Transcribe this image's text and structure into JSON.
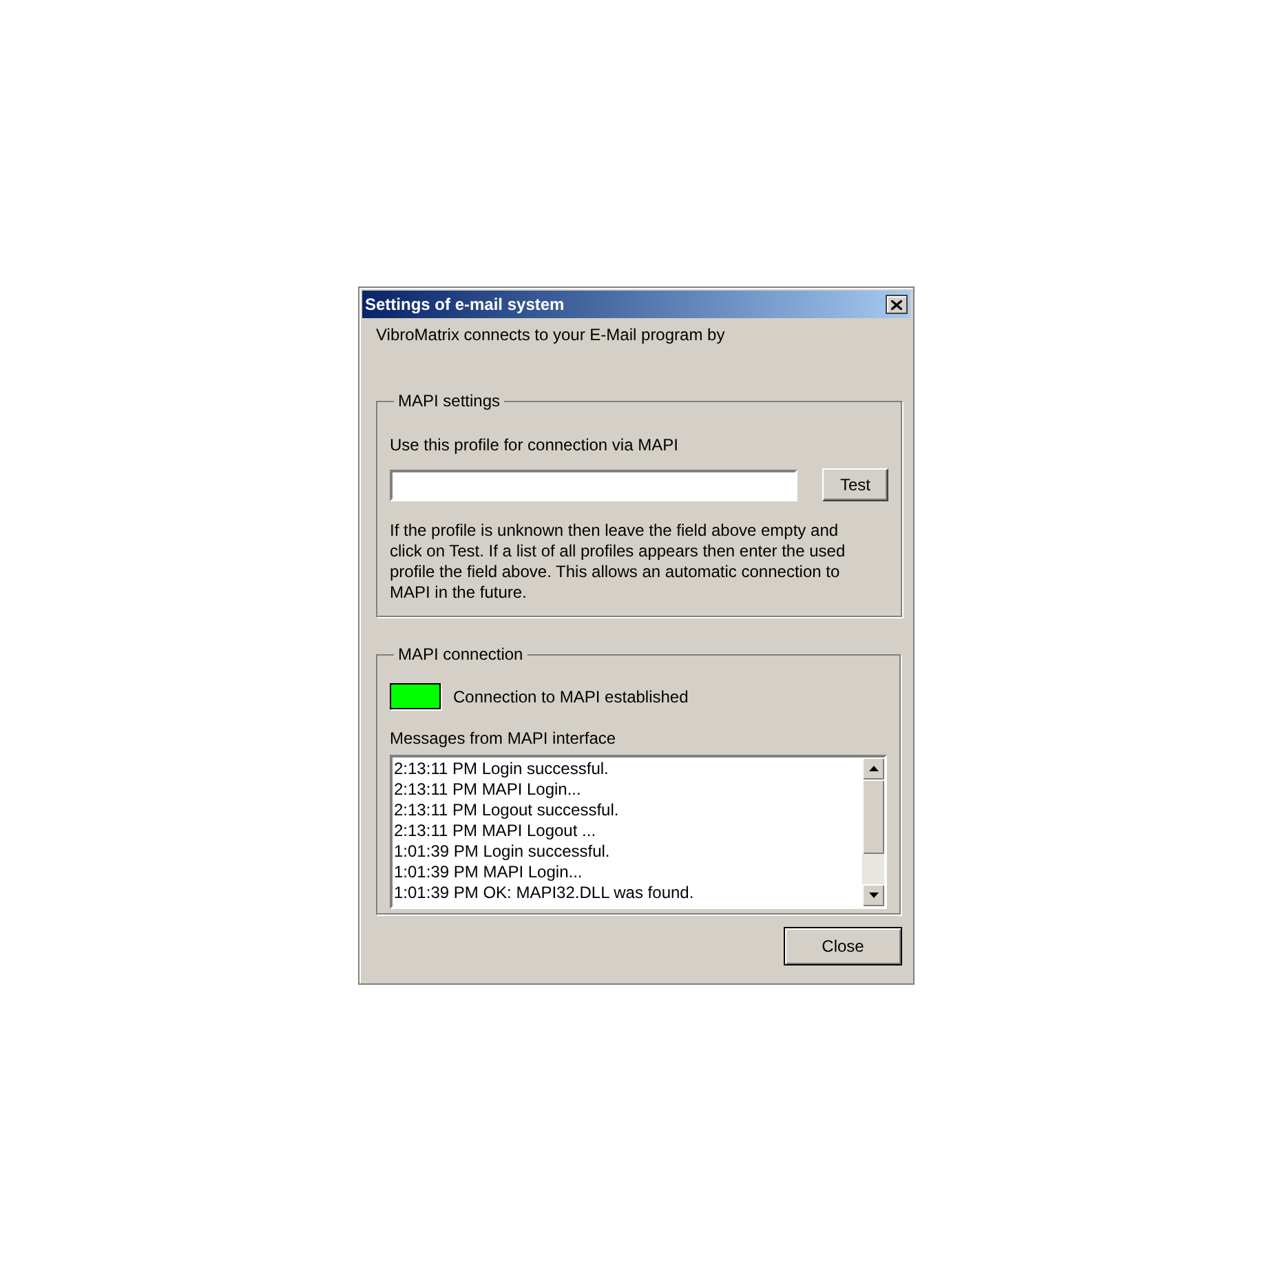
{
  "window": {
    "title": "Settings of e-mail system",
    "intro": "VibroMatrix connects to your E-Mail program by"
  },
  "mapi_settings": {
    "title": "MAPI settings",
    "label": "Use this profile for connection via MAPI",
    "test_button": "Test",
    "help": "If the profile is unknown then leave the field above empty and click on Test. If a list of all profiles appears then enter the used profile the field above. This allows an automatic connection to MAPI in the future."
  },
  "mapi_connection": {
    "title": "MAPI connection",
    "connected": true,
    "status": "Connection to MAPI established",
    "messages_label": "Messages from MAPI interface",
    "messages": [
      "2:13:11 PM Login successful.",
      "2:13:11 PM MAPI Login...",
      "2:13:11 PM Logout successful.",
      "2:13:11 PM MAPI Logout ...",
      "1:01:39 PM Login successful.",
      "1:01:39 PM MAPI Login...",
      "1:01:39 PM OK: MAPI32.DLL was found."
    ]
  },
  "buttons": [
    "Close"
  ]
}
